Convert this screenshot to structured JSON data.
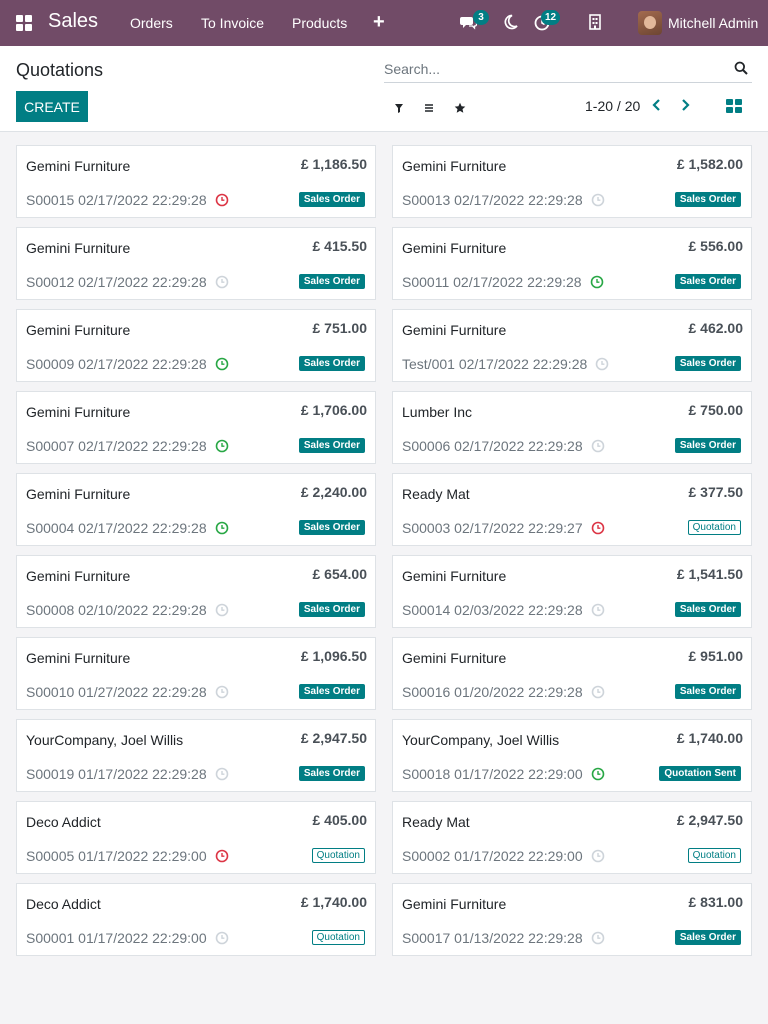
{
  "navbar": {
    "brand": "Sales",
    "menu": [
      "Orders",
      "To Invoice",
      "Products"
    ],
    "chat_count": "3",
    "activity_count": "12",
    "user_name": "Mitchell Admin"
  },
  "control_panel": {
    "title": "Quotations",
    "create_label": "CREATE",
    "search_placeholder": "Search...",
    "pager": "1-20 / 20"
  },
  "colors": {
    "brand": "#714b67",
    "accent": "#017e84",
    "clock_overdue": "#dc3545",
    "clock_planned": "#28a745",
    "clock_none": "#ced4da"
  },
  "cards": [
    {
      "partner": "Gemini Furniture",
      "amount": "£ 1,186.50",
      "ref": "S00015 02/17/2022 22:29:28",
      "activity": "overdue",
      "status": "Sales Order",
      "status_style": "filled"
    },
    {
      "partner": "Gemini Furniture",
      "amount": "£ 1,582.00",
      "ref": "S00013 02/17/2022 22:29:28",
      "activity": "none",
      "status": "Sales Order",
      "status_style": "filled"
    },
    {
      "partner": "Gemini Furniture",
      "amount": "£ 415.50",
      "ref": "S00012 02/17/2022 22:29:28",
      "activity": "none",
      "status": "Sales Order",
      "status_style": "filled"
    },
    {
      "partner": "Gemini Furniture",
      "amount": "£ 556.00",
      "ref": "S00011 02/17/2022 22:29:28",
      "activity": "planned",
      "status": "Sales Order",
      "status_style": "filled"
    },
    {
      "partner": "Gemini Furniture",
      "amount": "£ 751.00",
      "ref": "S00009 02/17/2022 22:29:28",
      "activity": "planned",
      "status": "Sales Order",
      "status_style": "filled"
    },
    {
      "partner": "Gemini Furniture",
      "amount": "£ 462.00",
      "ref": "Test/001 02/17/2022 22:29:28",
      "activity": "none",
      "status": "Sales Order",
      "status_style": "filled"
    },
    {
      "partner": "Gemini Furniture",
      "amount": "£ 1,706.00",
      "ref": "S00007 02/17/2022 22:29:28",
      "activity": "planned",
      "status": "Sales Order",
      "status_style": "filled"
    },
    {
      "partner": "Lumber Inc",
      "amount": "£ 750.00",
      "ref": "S00006 02/17/2022 22:29:28",
      "activity": "none",
      "status": "Sales Order",
      "status_style": "filled"
    },
    {
      "partner": "Gemini Furniture",
      "amount": "£ 2,240.00",
      "ref": "S00004 02/17/2022 22:29:28",
      "activity": "planned",
      "status": "Sales Order",
      "status_style": "filled"
    },
    {
      "partner": "Ready Mat",
      "amount": "£ 377.50",
      "ref": "S00003 02/17/2022 22:29:27",
      "activity": "overdue",
      "status": "Quotation",
      "status_style": "outline"
    },
    {
      "partner": "Gemini Furniture",
      "amount": "£ 654.00",
      "ref": "S00008 02/10/2022 22:29:28",
      "activity": "none",
      "status": "Sales Order",
      "status_style": "filled"
    },
    {
      "partner": "Gemini Furniture",
      "amount": "£ 1,541.50",
      "ref": "S00014 02/03/2022 22:29:28",
      "activity": "none",
      "status": "Sales Order",
      "status_style": "filled"
    },
    {
      "partner": "Gemini Furniture",
      "amount": "£ 1,096.50",
      "ref": "S00010 01/27/2022 22:29:28",
      "activity": "none",
      "status": "Sales Order",
      "status_style": "filled"
    },
    {
      "partner": "Gemini Furniture",
      "amount": "£ 951.00",
      "ref": "S00016 01/20/2022 22:29:28",
      "activity": "none",
      "status": "Sales Order",
      "status_style": "filled"
    },
    {
      "partner": "YourCompany, Joel Willis",
      "amount": "£ 2,947.50",
      "ref": "S00019 01/17/2022 22:29:28",
      "activity": "none",
      "status": "Sales Order",
      "status_style": "filled"
    },
    {
      "partner": "YourCompany, Joel Willis",
      "amount": "£ 1,740.00",
      "ref": "S00018 01/17/2022 22:29:00",
      "activity": "planned",
      "status": "Quotation Sent",
      "status_style": "filled"
    },
    {
      "partner": "Deco Addict",
      "amount": "£ 405.00",
      "ref": "S00005 01/17/2022 22:29:00",
      "activity": "overdue",
      "status": "Quotation",
      "status_style": "outline"
    },
    {
      "partner": "Ready Mat",
      "amount": "£ 2,947.50",
      "ref": "S00002 01/17/2022 22:29:00",
      "activity": "none",
      "status": "Quotation",
      "status_style": "outline"
    },
    {
      "partner": "Deco Addict",
      "amount": "£ 1,740.00",
      "ref": "S00001 01/17/2022 22:29:00",
      "activity": "none",
      "status": "Quotation",
      "status_style": "outline"
    },
    {
      "partner": "Gemini Furniture",
      "amount": "£ 831.00",
      "ref": "S00017 01/13/2022 22:29:28",
      "activity": "none",
      "status": "Sales Order",
      "status_style": "filled"
    }
  ]
}
